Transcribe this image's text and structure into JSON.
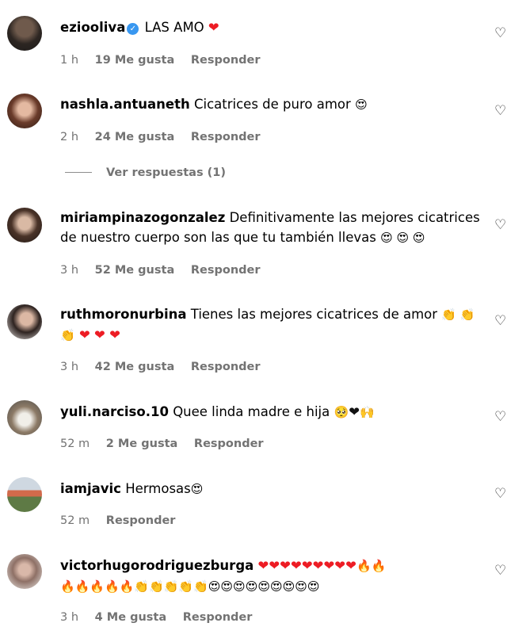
{
  "comments": [
    {
      "username": "eziooliva",
      "verified": true,
      "text": "LAS AMO",
      "emoji": "❤",
      "time": "1 h",
      "likes": "19 Me gusta",
      "reply": "Responder"
    },
    {
      "username": "nashla.antuaneth",
      "text": "Cicatrices de puro amor",
      "emoji": "😍",
      "time": "2 h",
      "likes": "24 Me gusta",
      "reply": "Responder",
      "view_replies": "Ver respuestas (1)"
    },
    {
      "username": "miriampinazogonzalez",
      "text_line1": "Definitivamente las mejores cicatrices",
      "text_line2": "de nuestro cuerpo son las que tu también llevas",
      "emoji": "😍 😍 😍",
      "time": "3 h",
      "likes": "52 Me gusta",
      "reply": "Responder"
    },
    {
      "username": "ruthmoronurbina",
      "text": "Tienes las mejores cicatrices de amor",
      "emoji_line1": "👏 👏",
      "emoji_line2_clap": "👏",
      "emoji_line2_hearts": "❤ ❤ ❤",
      "time": "3 h",
      "likes": "42 Me gusta",
      "reply": "Responder"
    },
    {
      "username": "yuli.narciso.10",
      "text": "Quee linda madre e hija",
      "emoji_a": "🥺",
      "emoji_b": "❤",
      "emoji_c": "🙌",
      "time": "52 m",
      "likes": "2 Me gusta",
      "reply": "Responder"
    },
    {
      "username": "iamjavic",
      "text": "Hermosas",
      "emoji": "😍",
      "time": "52 m",
      "reply": "Responder"
    },
    {
      "username": "victorhugorodriguezburga",
      "emoji_line1_hearts": "❤❤❤❤❤❤❤❤❤",
      "emoji_line1_fire": "🔥🔥",
      "emoji_line2_fire": "🔥🔥🔥🔥🔥",
      "emoji_line2_clap": "👏👏👏👏👏",
      "emoji_line2_eyes": "😍😍😍😍😍😍😍😍😍",
      "time": "3 h",
      "likes": "4 Me gusta",
      "reply": "Responder"
    }
  ],
  "colors": {
    "meta_text": "#737373",
    "verified_badge": "#3897f0",
    "heart_red": "#ed1c24"
  },
  "icons": {
    "like_button": "heart-outline-icon",
    "verified": "verified-badge-icon"
  }
}
